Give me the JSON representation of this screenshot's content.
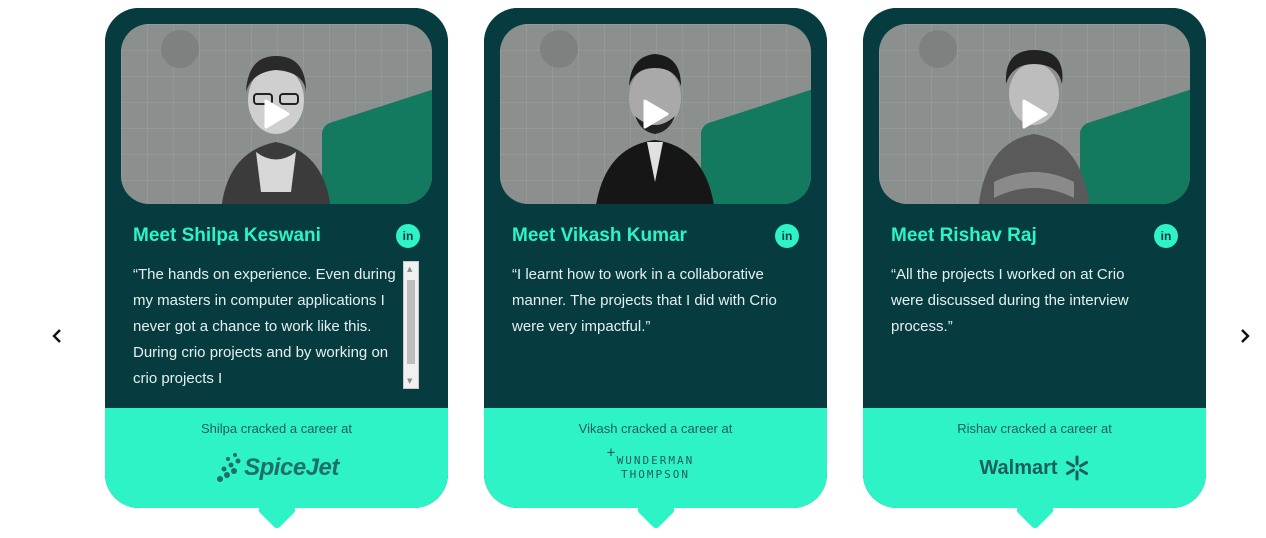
{
  "nav": {
    "prev_icon": "chevron-left-icon",
    "next_icon": "chevron-right-icon"
  },
  "colors": {
    "card_dark": "#063c40",
    "accent": "#2ef3c7",
    "text": "#e6efee"
  },
  "cards": [
    {
      "name": "Meet Shilpa Keswani",
      "quote": "“The hands on experience. Even during my masters in computer applications I never got a chance to work like this. During crio projects and by working on crio projects I",
      "cracked": "Shilpa cracked a career at",
      "company": "SpiceJet"
    },
    {
      "name": "Meet Vikash Kumar",
      "quote": "“I learnt how to work in a collaborative manner. The projects that I did with Crio were very impactful.”",
      "cracked": "Vikash cracked a career at",
      "company_line1": "WUNDERMAN",
      "company_line2": "THOMPSON"
    },
    {
      "name": "Meet Rishav Raj",
      "quote": "“All the projects I worked on at Crio were discussed during the interview process.”",
      "cracked": "Rishav cracked a career at",
      "company": "Walmart"
    }
  ],
  "linkedin_label": "in"
}
